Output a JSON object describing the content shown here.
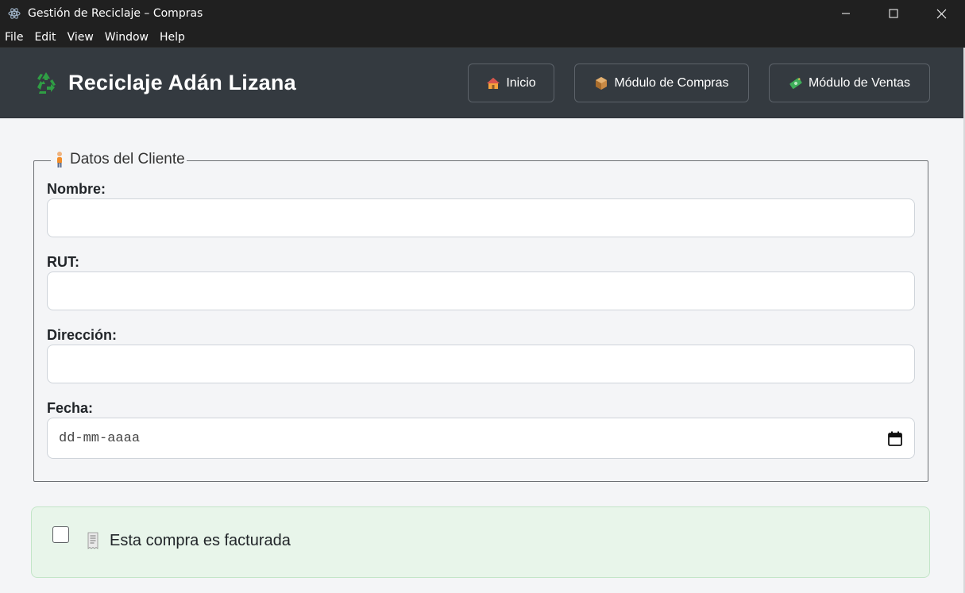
{
  "window": {
    "title": "Gestión de Reciclaje – Compras",
    "controls": [
      "minimize",
      "maximize",
      "close"
    ]
  },
  "menubar": {
    "items": [
      "File",
      "Edit",
      "View",
      "Window",
      "Help"
    ]
  },
  "header": {
    "brand_icon": "recycle-icon",
    "brand_text": "Reciclaje Adán Lizana",
    "nav": [
      {
        "icon": "house-icon",
        "label": "Inicio"
      },
      {
        "icon": "package-icon",
        "label": "Módulo de Compras"
      },
      {
        "icon": "money-icon",
        "label": "Módulo de Ventas"
      }
    ]
  },
  "client_section": {
    "legend_icon": "person-icon",
    "legend": "Datos del Cliente",
    "fields": [
      {
        "label": "Nombre:",
        "value": ""
      },
      {
        "label": "RUT:",
        "value": ""
      },
      {
        "label": "Dirección:",
        "value": ""
      },
      {
        "label": "Fecha:",
        "value": "",
        "placeholder": "dd-mm-aaaa"
      }
    ]
  },
  "invoice": {
    "checked": false,
    "icon": "receipt-icon",
    "label": "Esta compra es facturada"
  },
  "colors": {
    "titlebar_bg": "#202020",
    "header_bg": "#343a40",
    "page_bg": "#f4f5f7",
    "invoice_bg": "#e8f5ea",
    "recycle_green": "#2f9e44"
  }
}
